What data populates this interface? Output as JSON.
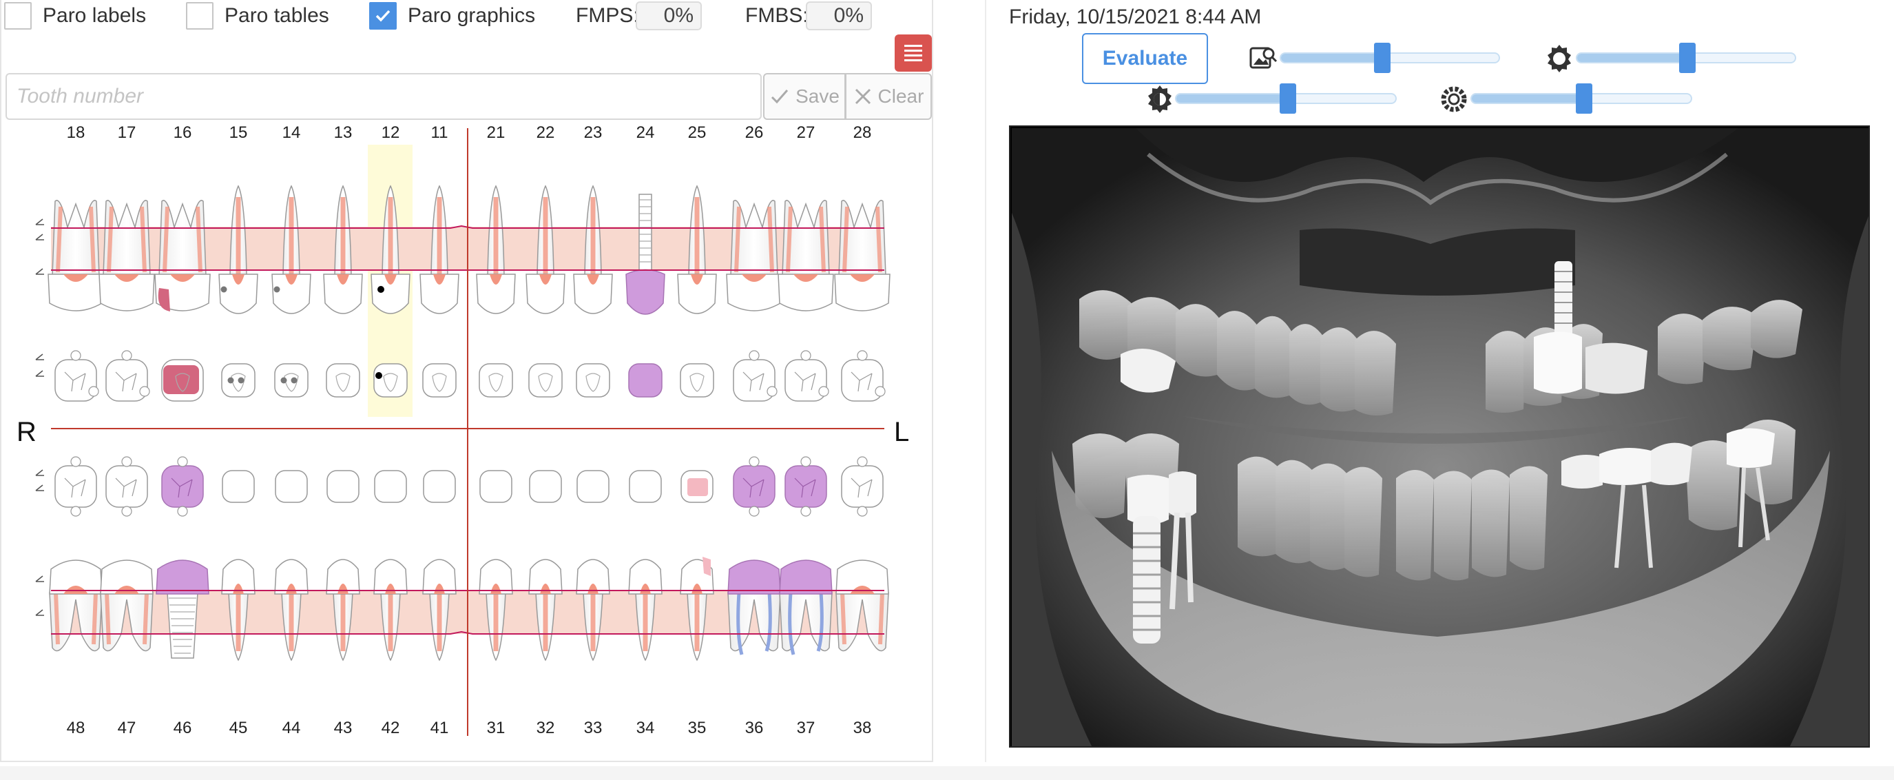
{
  "toolbar": {
    "paro_labels": "Paro labels",
    "paro_tables": "Paro tables",
    "paro_graphics": "Paro graphics",
    "paro_labels_checked": false,
    "paro_tables_checked": false,
    "paro_graphics_checked": true,
    "fmps_label": "FMPS:",
    "fmps_value": "0%",
    "fmbs_label": "FMBS:",
    "fmbs_value": "0%",
    "menu_icon": "list-icon"
  },
  "tooth_input": {
    "placeholder": "Tooth number",
    "value": ""
  },
  "buttons": {
    "save": "Save",
    "clear": "Clear",
    "evaluate": "Evaluate"
  },
  "chart": {
    "upper_teeth": [
      "18",
      "17",
      "16",
      "15",
      "14",
      "13",
      "12",
      "11",
      "21",
      "22",
      "23",
      "24",
      "25",
      "26",
      "27",
      "28"
    ],
    "lower_teeth": [
      "48",
      "47",
      "46",
      "45",
      "44",
      "43",
      "42",
      "41",
      "31",
      "32",
      "33",
      "34",
      "35",
      "36",
      "37",
      "38"
    ],
    "side_right": "R",
    "side_left": "L",
    "selected_tooth": "12",
    "colors": {
      "accent": "#4a90e2",
      "midline": "#c0392b",
      "paro_band": "#f8d9cf",
      "pulp": "#f29580",
      "restoration": "#cf9bdc",
      "lesion": "#d3667f",
      "selection": "#fefbd8",
      "menu_button": "#d9534f"
    }
  },
  "image_panel": {
    "timestamp": "Friday, 10/15/2021 8:44 AM",
    "sliders": [
      {
        "icon": "image-search-icon",
        "value": 0.45
      },
      {
        "icon": "brightness-icon",
        "value": 0.49
      },
      {
        "icon": "contrast-icon",
        "value": 0.5
      },
      {
        "icon": "gamma-icon",
        "value": 0.5
      }
    ]
  }
}
